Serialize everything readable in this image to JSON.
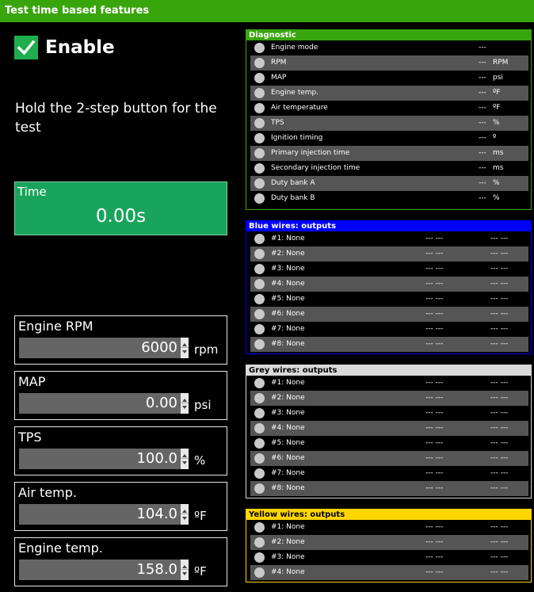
{
  "window": {
    "title": "Test time based features"
  },
  "enable": {
    "label": "Enable",
    "checked": true
  },
  "instruction": "Hold the 2-step button for the test",
  "time": {
    "label": "Time",
    "value": "0.00s"
  },
  "params": [
    {
      "label": "Engine RPM",
      "value": "6000",
      "unit": "rpm"
    },
    {
      "label": "MAP",
      "value": "0.00",
      "unit": "psi"
    },
    {
      "label": "TPS",
      "value": "100.0",
      "unit": "%"
    },
    {
      "label": "Air temp.",
      "value": "104.0",
      "unit": "ºF"
    },
    {
      "label": "Engine temp.",
      "value": "158.0",
      "unit": "ºF"
    }
  ],
  "diagnostic": {
    "title": "Diagnostic",
    "color": "#39a50d",
    "rows": [
      {
        "label": "Engine mode",
        "value": "---",
        "unit": ""
      },
      {
        "label": "RPM",
        "value": "---",
        "unit": "RPM"
      },
      {
        "label": "MAP",
        "value": "---",
        "unit": "psi"
      },
      {
        "label": "Engine temp.",
        "value": "---",
        "unit": "ºF"
      },
      {
        "label": "Air temperature",
        "value": "---",
        "unit": "ºF"
      },
      {
        "label": "TPS",
        "value": "---",
        "unit": "%"
      },
      {
        "label": "Ignition timing",
        "value": "---",
        "unit": "º"
      },
      {
        "label": "Primary injection time",
        "value": "---",
        "unit": "ms"
      },
      {
        "label": "Secondary injection time",
        "value": "---",
        "unit": "ms"
      },
      {
        "label": "Duty bank A",
        "value": "---",
        "unit": "%"
      },
      {
        "label": "Duty bank B",
        "value": "---",
        "unit": "%"
      }
    ]
  },
  "blue": {
    "title": "Blue wires: outputs",
    "color": "#0000ff",
    "rows": [
      {
        "label": "#1: None",
        "a": "--- ---",
        "b": "--- ---"
      },
      {
        "label": "#2: None",
        "a": "--- ---",
        "b": "--- ---"
      },
      {
        "label": "#3: None",
        "a": "--- ---",
        "b": "--- ---"
      },
      {
        "label": "#4: None",
        "a": "--- ---",
        "b": "--- ---"
      },
      {
        "label": "#5: None",
        "a": "--- ---",
        "b": "--- ---"
      },
      {
        "label": "#6: None",
        "a": "--- ---",
        "b": "--- ---"
      },
      {
        "label": "#7: None",
        "a": "--- ---",
        "b": "--- ---"
      },
      {
        "label": "#8: None",
        "a": "--- ---",
        "b": "--- ---"
      }
    ]
  },
  "grey": {
    "title": "Grey wires: outputs",
    "color": "#d9d9d9",
    "rows": [
      {
        "label": "#1: None",
        "a": "--- ---",
        "b": "--- ---"
      },
      {
        "label": "#2: None",
        "a": "--- ---",
        "b": "--- ---"
      },
      {
        "label": "#3: None",
        "a": "--- ---",
        "b": "--- ---"
      },
      {
        "label": "#4: None",
        "a": "--- ---",
        "b": "--- ---"
      },
      {
        "label": "#5: None",
        "a": "--- ---",
        "b": "--- ---"
      },
      {
        "label": "#6: None",
        "a": "--- ---",
        "b": "--- ---"
      },
      {
        "label": "#7: None",
        "a": "--- ---",
        "b": "--- ---"
      },
      {
        "label": "#8: None",
        "a": "--- ---",
        "b": "--- ---"
      }
    ]
  },
  "yellow": {
    "title": "Yellow wires: outputs",
    "color": "#ffd500",
    "rows": [
      {
        "label": "#1: None",
        "a": "--- ---",
        "b": "--- ---"
      },
      {
        "label": "#2: None",
        "a": "--- ---",
        "b": "--- ---"
      },
      {
        "label": "#3: None",
        "a": "--- ---",
        "b": "--- ---"
      },
      {
        "label": "#4: None",
        "a": "--- ---",
        "b": "--- ---"
      }
    ]
  }
}
